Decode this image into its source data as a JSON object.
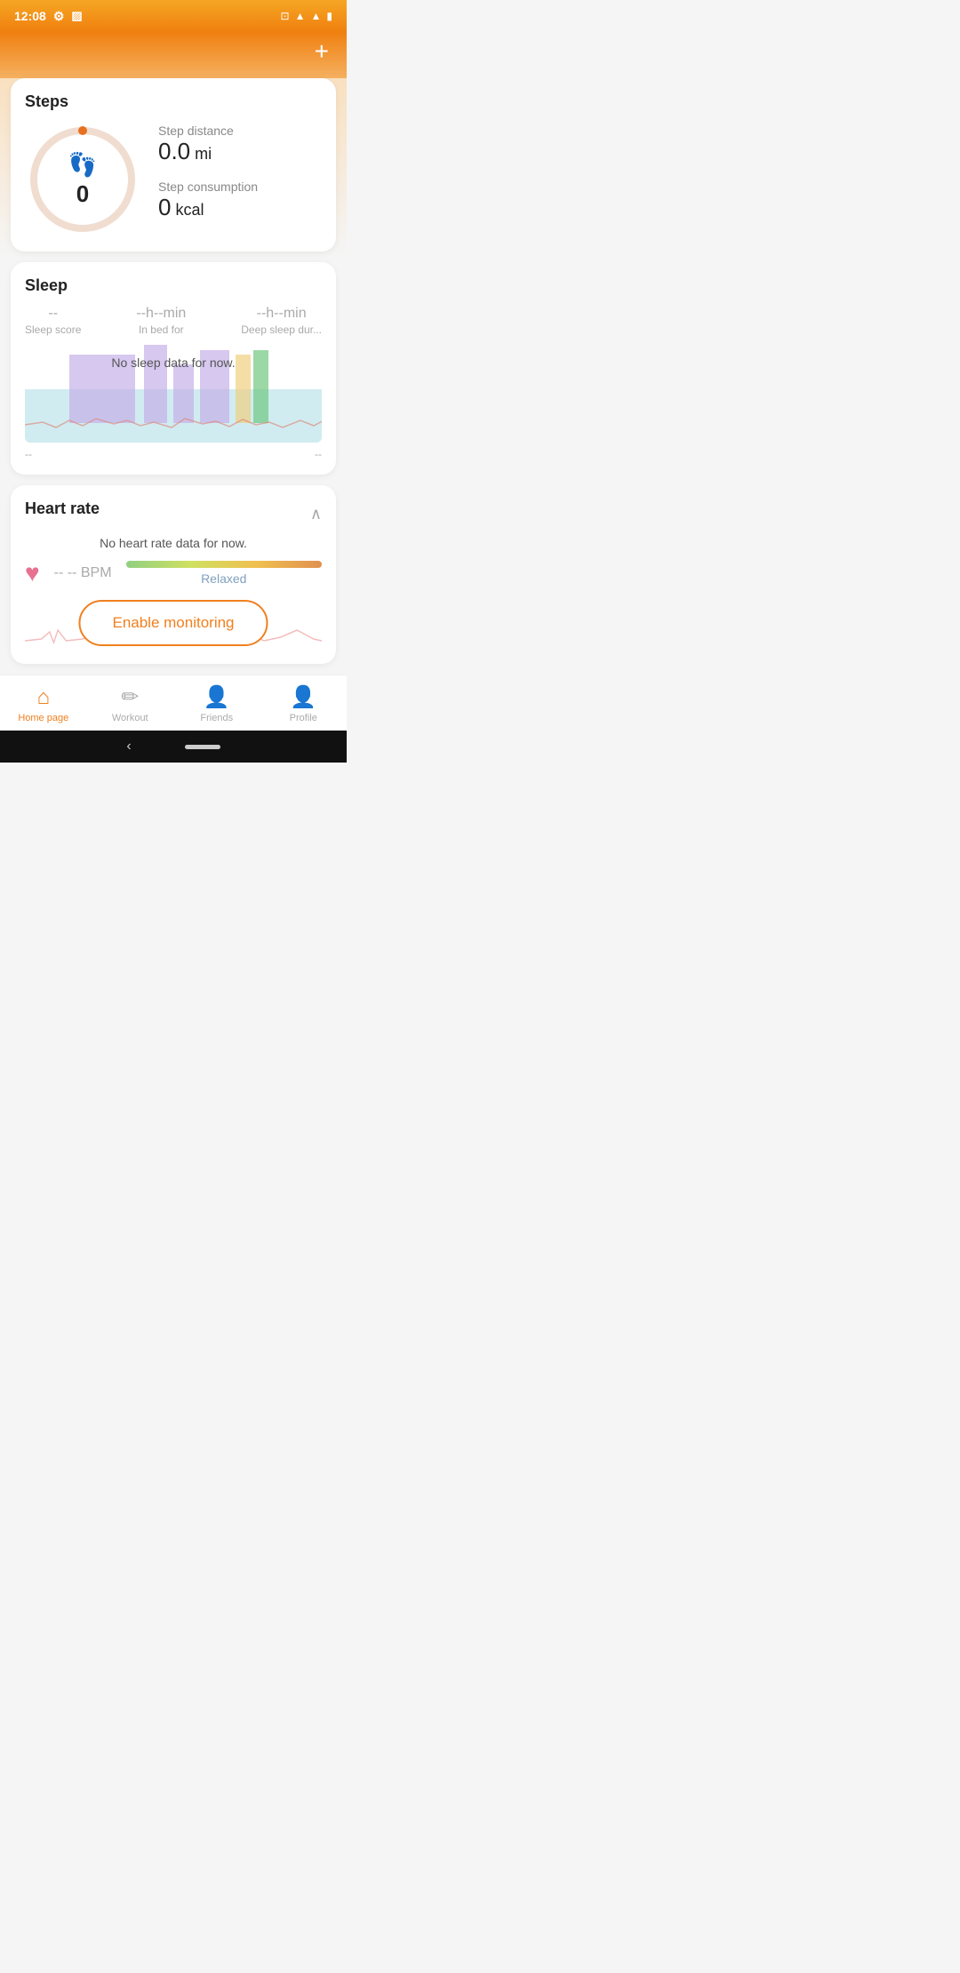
{
  "status": {
    "time": "12:08",
    "icons": [
      "settings",
      "cast",
      "wifi",
      "signal",
      "battery"
    ]
  },
  "header": {
    "add_label": "+"
  },
  "steps_card": {
    "title": "Steps",
    "count": "0",
    "step_distance_label": "Step distance",
    "step_distance_value": "0.0",
    "step_distance_unit": "mi",
    "step_consumption_label": "Step consumption",
    "step_consumption_value": "0",
    "step_consumption_unit": "kcal"
  },
  "sleep_card": {
    "title": "Sleep",
    "score_value": "--",
    "score_label": "Sleep score",
    "in_bed_value": "--h--min",
    "in_bed_label": "In bed for",
    "deep_sleep_value": "--h--min",
    "deep_sleep_label": "Deep sleep dur...",
    "no_data_text": "No sleep data for now.",
    "time_start": "--",
    "time_end": "--"
  },
  "heart_rate_card": {
    "title": "Heart rate",
    "no_data_text": "No heart rate data for now.",
    "bpm_value": "-- --",
    "bpm_label": "BPM",
    "status_label": "Relaxed",
    "enable_btn_label": "Enable monitoring"
  },
  "bottom_nav": {
    "items": [
      {
        "id": "home",
        "label": "Home page",
        "active": true
      },
      {
        "id": "workout",
        "label": "Workout",
        "active": false
      },
      {
        "id": "friends",
        "label": "Friends",
        "active": false
      },
      {
        "id": "profile",
        "label": "Profile",
        "active": false
      }
    ]
  }
}
